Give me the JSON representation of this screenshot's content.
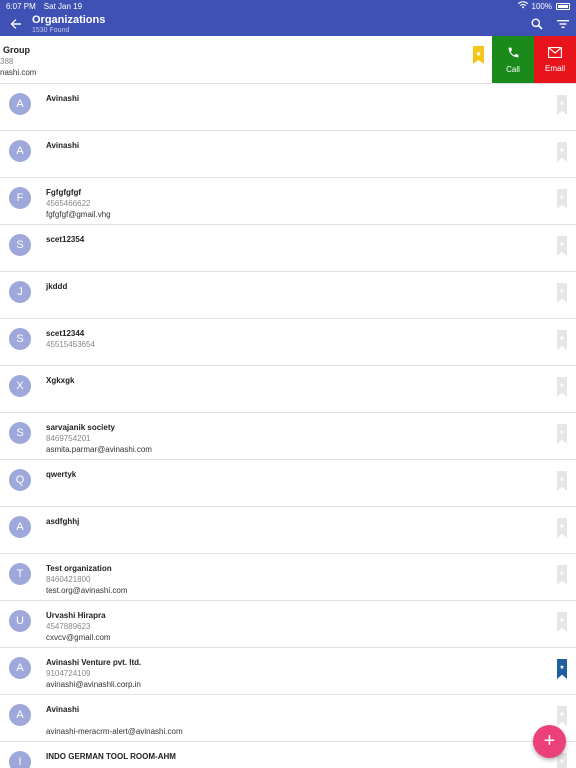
{
  "status_bar": {
    "time": "6:07 PM",
    "date": "Sat Jan 19",
    "battery": "100%"
  },
  "header": {
    "title": "Organizations",
    "subtitle": "1530 Found"
  },
  "swiped_row": {
    "name": "Group",
    "phone": "388",
    "email": "nashi.com",
    "call_label": "Call",
    "email_label": "Email"
  },
  "rows": [
    {
      "initial": "A",
      "name": "Avinashi",
      "phone": "",
      "email": "",
      "bookmarked": false
    },
    {
      "initial": "A",
      "name": "Avinashi",
      "phone": "",
      "email": "",
      "bookmarked": false
    },
    {
      "initial": "F",
      "name": "Fgfgfgfgf",
      "phone": "4565466622",
      "email": "fgfgfgf@gmail.vhg",
      "bookmarked": false
    },
    {
      "initial": "S",
      "name": "scet12354",
      "phone": "",
      "email": "",
      "bookmarked": false
    },
    {
      "initial": "J",
      "name": "jkddd",
      "phone": "",
      "email": "",
      "bookmarked": false
    },
    {
      "initial": "S",
      "name": "scet12344",
      "phone": "45515453654",
      "email": "",
      "bookmarked": false
    },
    {
      "initial": "X",
      "name": "Xgkxgk",
      "phone": "",
      "email": "",
      "bookmarked": false
    },
    {
      "initial": "S",
      "name": "sarvajanik society",
      "phone": "8469754201",
      "email": "asmita.parmar@avinashi.com",
      "bookmarked": false
    },
    {
      "initial": "Q",
      "name": "qwertyk",
      "phone": "",
      "email": "",
      "bookmarked": false
    },
    {
      "initial": "A",
      "name": "asdfghhj",
      "phone": "",
      "email": "",
      "bookmarked": false
    },
    {
      "initial": "T",
      "name": "Test organization",
      "phone": "8460421800",
      "email": "test.org@avinashi.com",
      "bookmarked": false
    },
    {
      "initial": "U",
      "name": "Urvashi Hirapra",
      "phone": "4547889623",
      "email": "cxvcv@gmail.com",
      "bookmarked": false
    },
    {
      "initial": "A",
      "name": "Avinashi Venture pvt. ltd.",
      "phone": "9104724109",
      "email": "avinashi@avinashli.corp.in",
      "bookmarked": true
    },
    {
      "initial": "A",
      "name": "Avinashi",
      "phone": "",
      "email": "avinashi-meracrm-alert@avinashi.com",
      "bookmarked": false
    },
    {
      "initial": "I",
      "name": "INDO GERMAN TOOL ROOM-AHM",
      "phone": "",
      "email": "",
      "bookmarked": false
    }
  ],
  "fab_label": "+",
  "colors": {
    "primary": "#3f51b5",
    "avatar": "#9fa8da",
    "call": "#1a8a1a",
    "email": "#e8141c",
    "fab": "#ec407a",
    "bookmark_on": "#1f5fa0",
    "bookmark_swiped": "#f5c518"
  }
}
